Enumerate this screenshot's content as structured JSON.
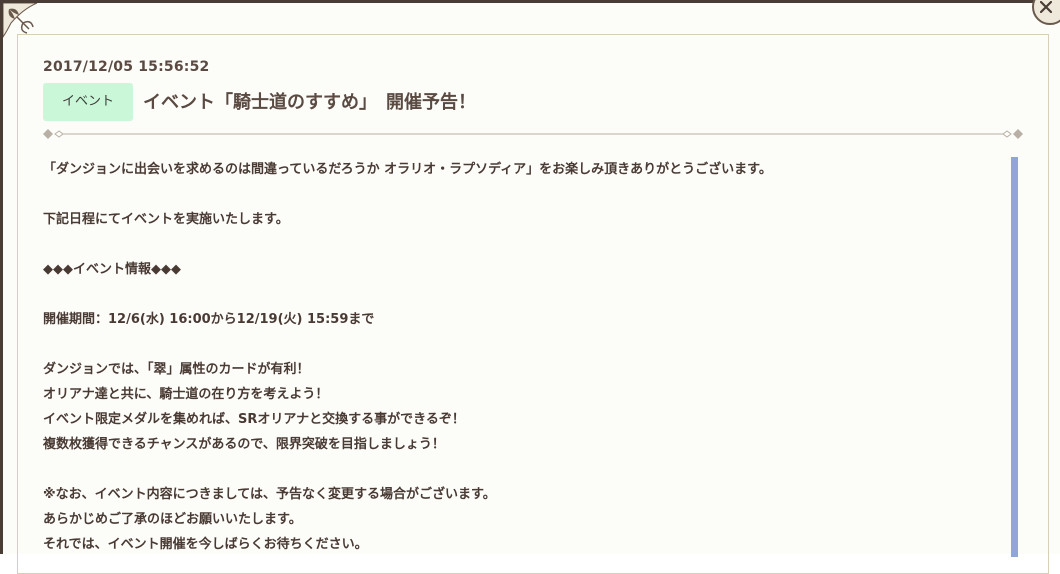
{
  "notice": {
    "timestamp": "2017/12/05 15:56:52",
    "category": "イベント",
    "title": "イベント「騎士道のすすめ」　開催予告！"
  },
  "body": {
    "lines": [
      "「ダンジョンに出会いを求めるのは間違っているだろうか オラリオ・ラプソディア」をお楽しみ頂きありがとうございます。",
      "",
      "下記日程にてイベントを実施いたします。",
      "",
      "◆◆◆イベント情報◆◆◆",
      "",
      "開催期間：12/6(水) 16:00から12/19(火) 15:59まで",
      "",
      "ダンジョンでは、「翠」属性のカードが有利！",
      "オリアナ達と共に、騎士道の在り方を考えよう！",
      "イベント限定メダルを集めれば、SRオリアナと交換する事ができるぞ！",
      "複数枚獲得できるチャンスがあるので、限界突破を目指しましょう！",
      "",
      "※なお、イベント内容につきましては、予告なく変更する場合がございます。",
      "あらかじめご了承のほどお願いいたします。",
      "それでは、イベント開催を今しばらくお待ちください。"
    ]
  },
  "icons": {
    "close": "close-icon",
    "corner": "fleur-de-lis-corner-icon"
  },
  "colors": {
    "badge_bg": "#c9f7d8",
    "text": "#4a3a34",
    "scrollbar": "#8fa6d6"
  }
}
